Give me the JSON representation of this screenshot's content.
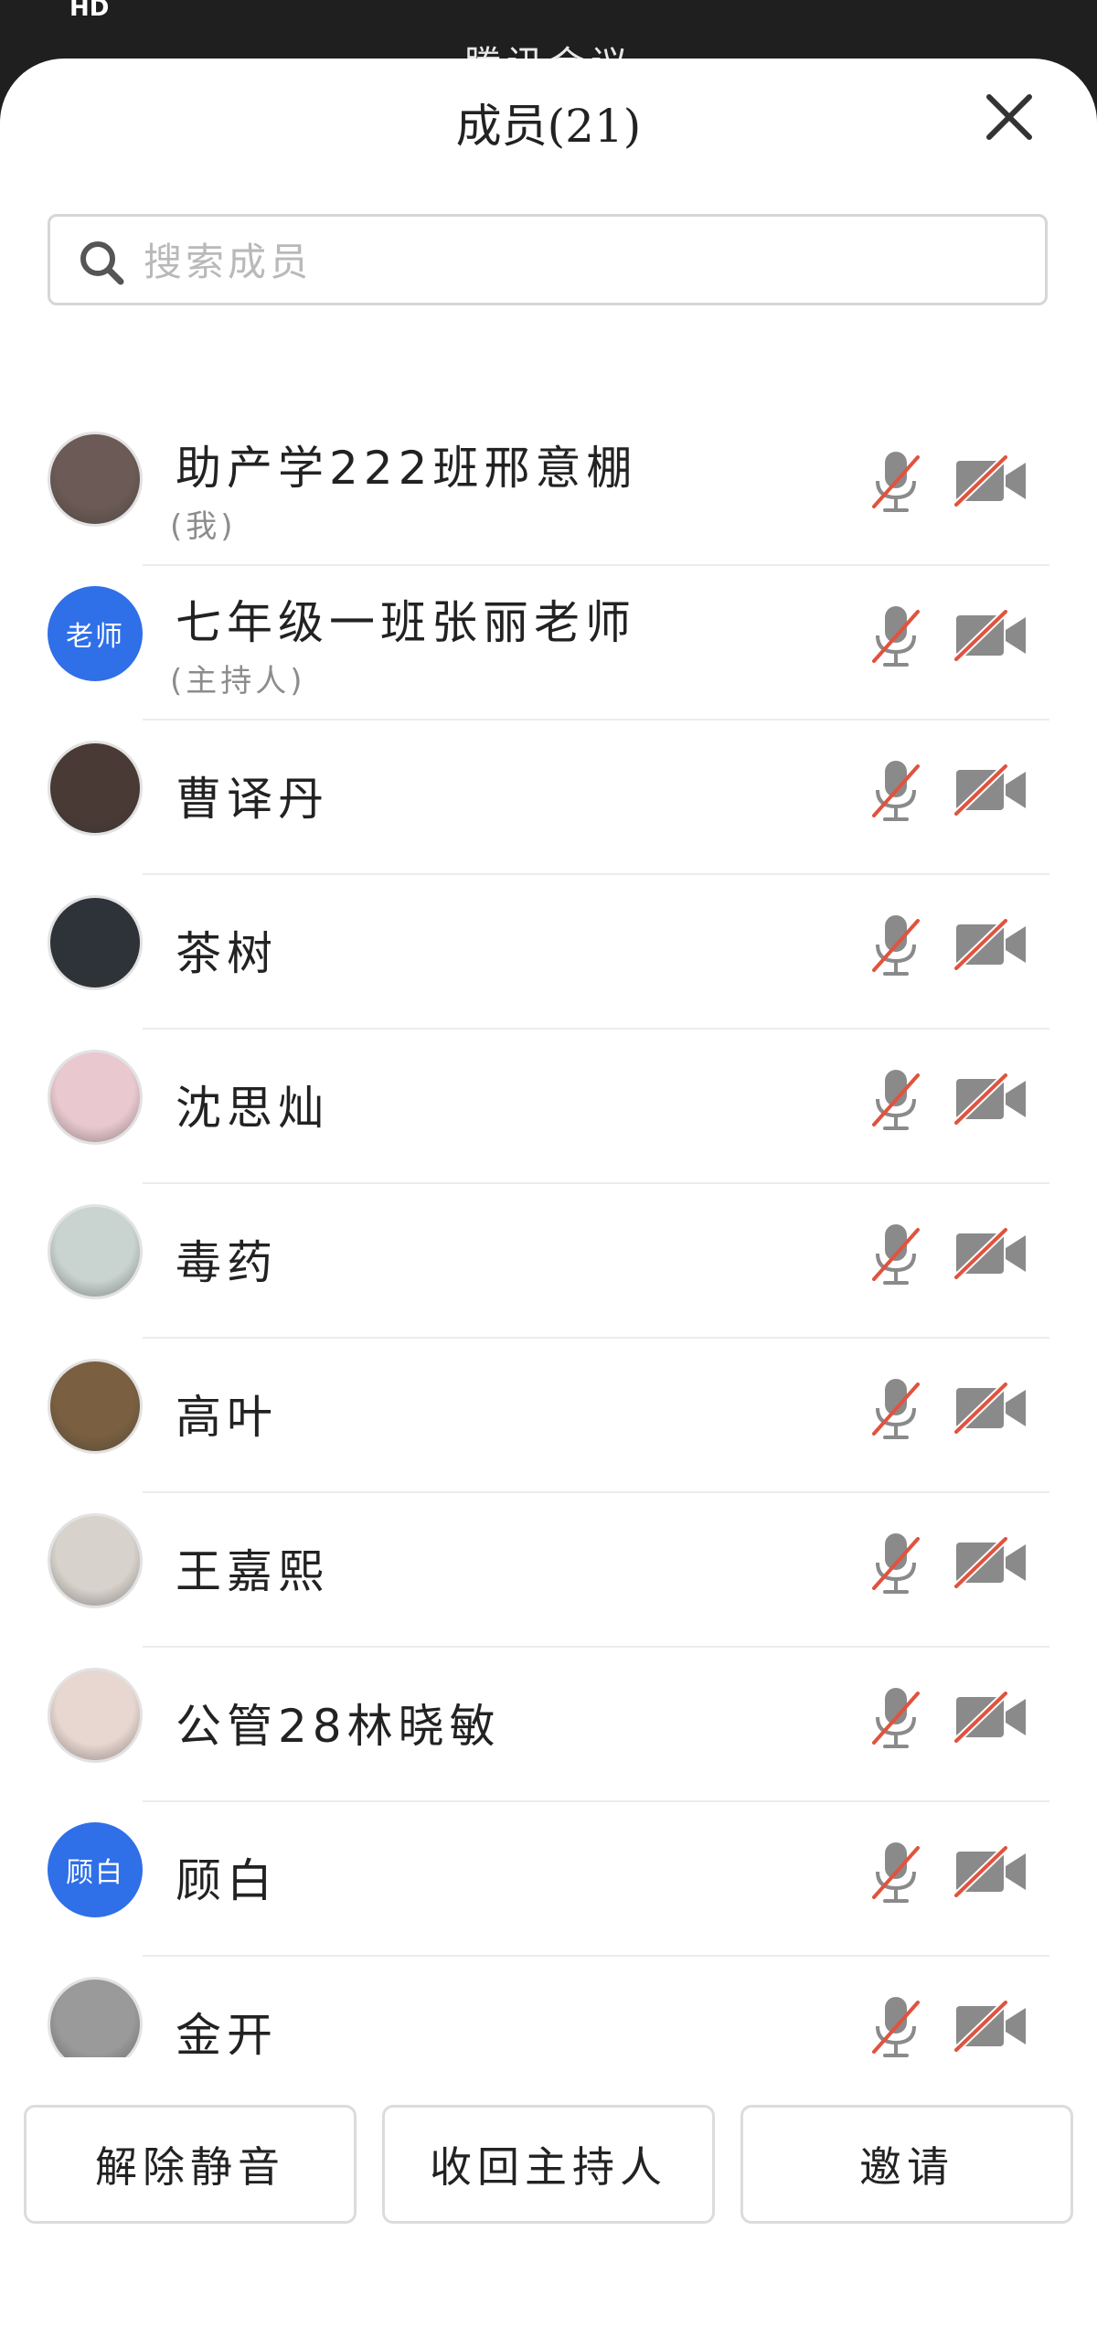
{
  "status": {
    "hd_label": "HD"
  },
  "app": {
    "title": "腾讯会议"
  },
  "header": {
    "title": "成员(21)"
  },
  "search": {
    "placeholder": "搜索成员",
    "value": ""
  },
  "members": [
    {
      "name": "助产学222班邢意棚",
      "role": "(我)",
      "avatar": "photo",
      "avatar_color": "#6b5a55",
      "mic": "muted",
      "camera": "off"
    },
    {
      "name": "七年级一班张丽老师",
      "role": "(主持人)",
      "avatar": "text",
      "avatar_text": "老师",
      "avatar_color": "#2f6fe8",
      "mic": "muted",
      "camera": "off"
    },
    {
      "name": "曹译丹",
      "role": "",
      "avatar": "photo",
      "avatar_color": "#4a3a35",
      "mic": "muted",
      "camera": "off"
    },
    {
      "name": "茶树",
      "role": "",
      "avatar": "photo",
      "avatar_color": "#2d3338",
      "mic": "muted",
      "camera": "off"
    },
    {
      "name": "沈思灿",
      "role": "",
      "avatar": "photo",
      "avatar_color": "#e9c9cf",
      "mic": "muted",
      "camera": "off"
    },
    {
      "name": "毒药",
      "role": "",
      "avatar": "photo",
      "avatar_color": "#c9d3cf",
      "mic": "muted",
      "camera": "off"
    },
    {
      "name": "高叶",
      "role": "",
      "avatar": "photo",
      "avatar_color": "#7a6040",
      "mic": "muted",
      "camera": "off"
    },
    {
      "name": "王嘉熙",
      "role": "",
      "avatar": "photo",
      "avatar_color": "#d8d2cc",
      "mic": "muted",
      "camera": "off"
    },
    {
      "name": "公管28林晓敏",
      "role": "",
      "avatar": "photo",
      "avatar_color": "#e8d6d0",
      "mic": "muted",
      "camera": "off"
    },
    {
      "name": "顾白",
      "role": "",
      "avatar": "text",
      "avatar_text": "顾白",
      "avatar_color": "#2f6fe8",
      "mic": "muted",
      "camera": "off"
    },
    {
      "name": "金开",
      "role": "",
      "avatar": "photo",
      "avatar_color": "#9a9a9a",
      "mic": "muted",
      "camera": "off"
    }
  ],
  "footer": {
    "unmute_label": "解除静音",
    "reclaim_host_label": "收回主持人",
    "invite_label": "邀请"
  },
  "colors": {
    "accent_blue": "#2f6fe8",
    "muted_red": "#e0533f",
    "icon_gray": "#8a8a8a"
  }
}
